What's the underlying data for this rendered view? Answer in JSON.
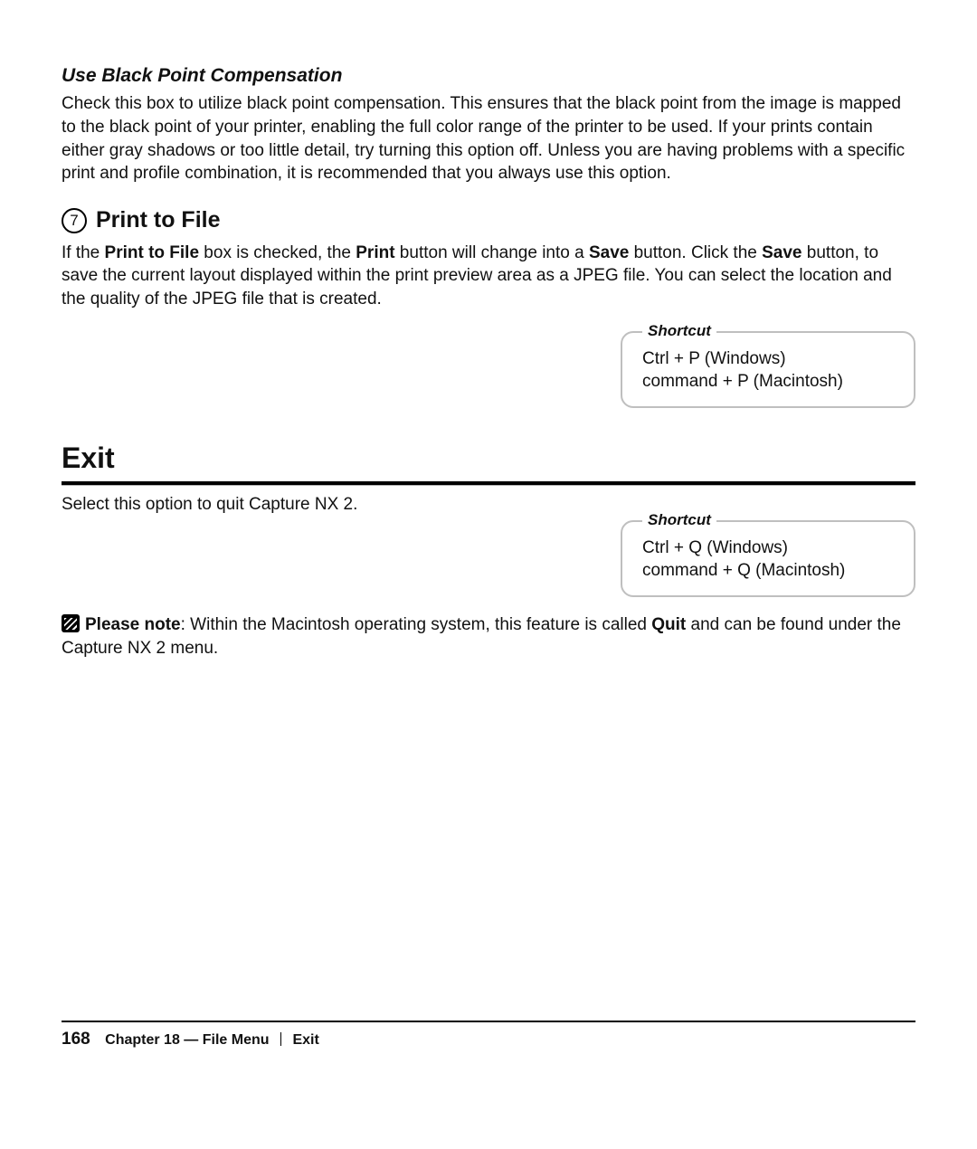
{
  "section_blackpoint": {
    "heading": "Use Black Point Compensation",
    "body": "Check this box to utilize black point compensation. This ensures that the black point from the image is mapped to the black point of your printer, enabling the full color range of the printer to be used. If your prints contain either gray shadows or too little detail, try turning this option off. Unless you are having problems with a specific print and profile combination, it is recommended that you always use this option."
  },
  "section_printtofile": {
    "number": "7",
    "heading": "Print to File",
    "body_pre": "If the ",
    "b1": "Print to File",
    "body_mid1": " box is checked, the ",
    "b2": "Print",
    "body_mid2": " button will change into a ",
    "b3": "Save",
    "body_mid3": " button. Click the ",
    "b4": "Save",
    "body_tail": " button, to save the current layout displayed within the print preview area as a JPEG file. You can select the location and the quality of the JPEG file that is created.",
    "shortcut": {
      "label": "Shortcut",
      "win": "Ctrl + P (Windows)",
      "mac": "command + P (Macintosh)"
    }
  },
  "section_exit": {
    "heading": "Exit",
    "body": "Select this option to quit Capture NX 2.",
    "shortcut": {
      "label": "Shortcut",
      "win": "Ctrl + Q (Windows)",
      "mac": "command + Q (Macintosh)"
    },
    "note": {
      "lead": "Please note",
      "pre": ": Within the Macintosh operating system, this feature is called ",
      "bold": "Quit",
      "tail": " and can be found under the Capture NX 2 menu."
    }
  },
  "footer": {
    "page": "168",
    "chapter": "Chapter 18 — File Menu",
    "section": "Exit"
  }
}
